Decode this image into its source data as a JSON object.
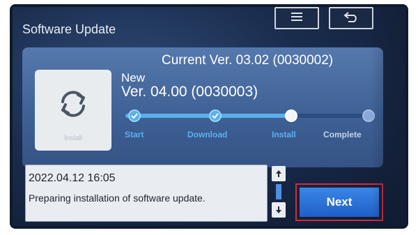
{
  "title": "Software Update",
  "header": {
    "menu_icon": "menu-icon",
    "back_icon": "back-icon"
  },
  "current_version": "Current Ver. 03.02 (0030002)",
  "install_tile": {
    "icon": "refresh-icon",
    "label": "Install"
  },
  "new_version": {
    "label": "New",
    "version": "Ver. 04.00 (0030003)"
  },
  "progress": {
    "steps": [
      {
        "label": "Start",
        "state": "done"
      },
      {
        "label": "Download",
        "state": "done"
      },
      {
        "label": "Install",
        "state": "current"
      },
      {
        "label": "Complete",
        "state": "pending"
      }
    ],
    "completed_fraction": 0.67
  },
  "message": {
    "timestamp": "2022.04.12 16:05",
    "text": "Preparing installation of software update."
  },
  "scroll": {
    "up_icon": "arrow-up-icon",
    "down_icon": "arrow-down-icon"
  },
  "next_button": "Next",
  "colors": {
    "accent_blue": "#5ab0ec",
    "button_blue": "#1f5fc7",
    "highlight_red": "#d62a3a"
  }
}
